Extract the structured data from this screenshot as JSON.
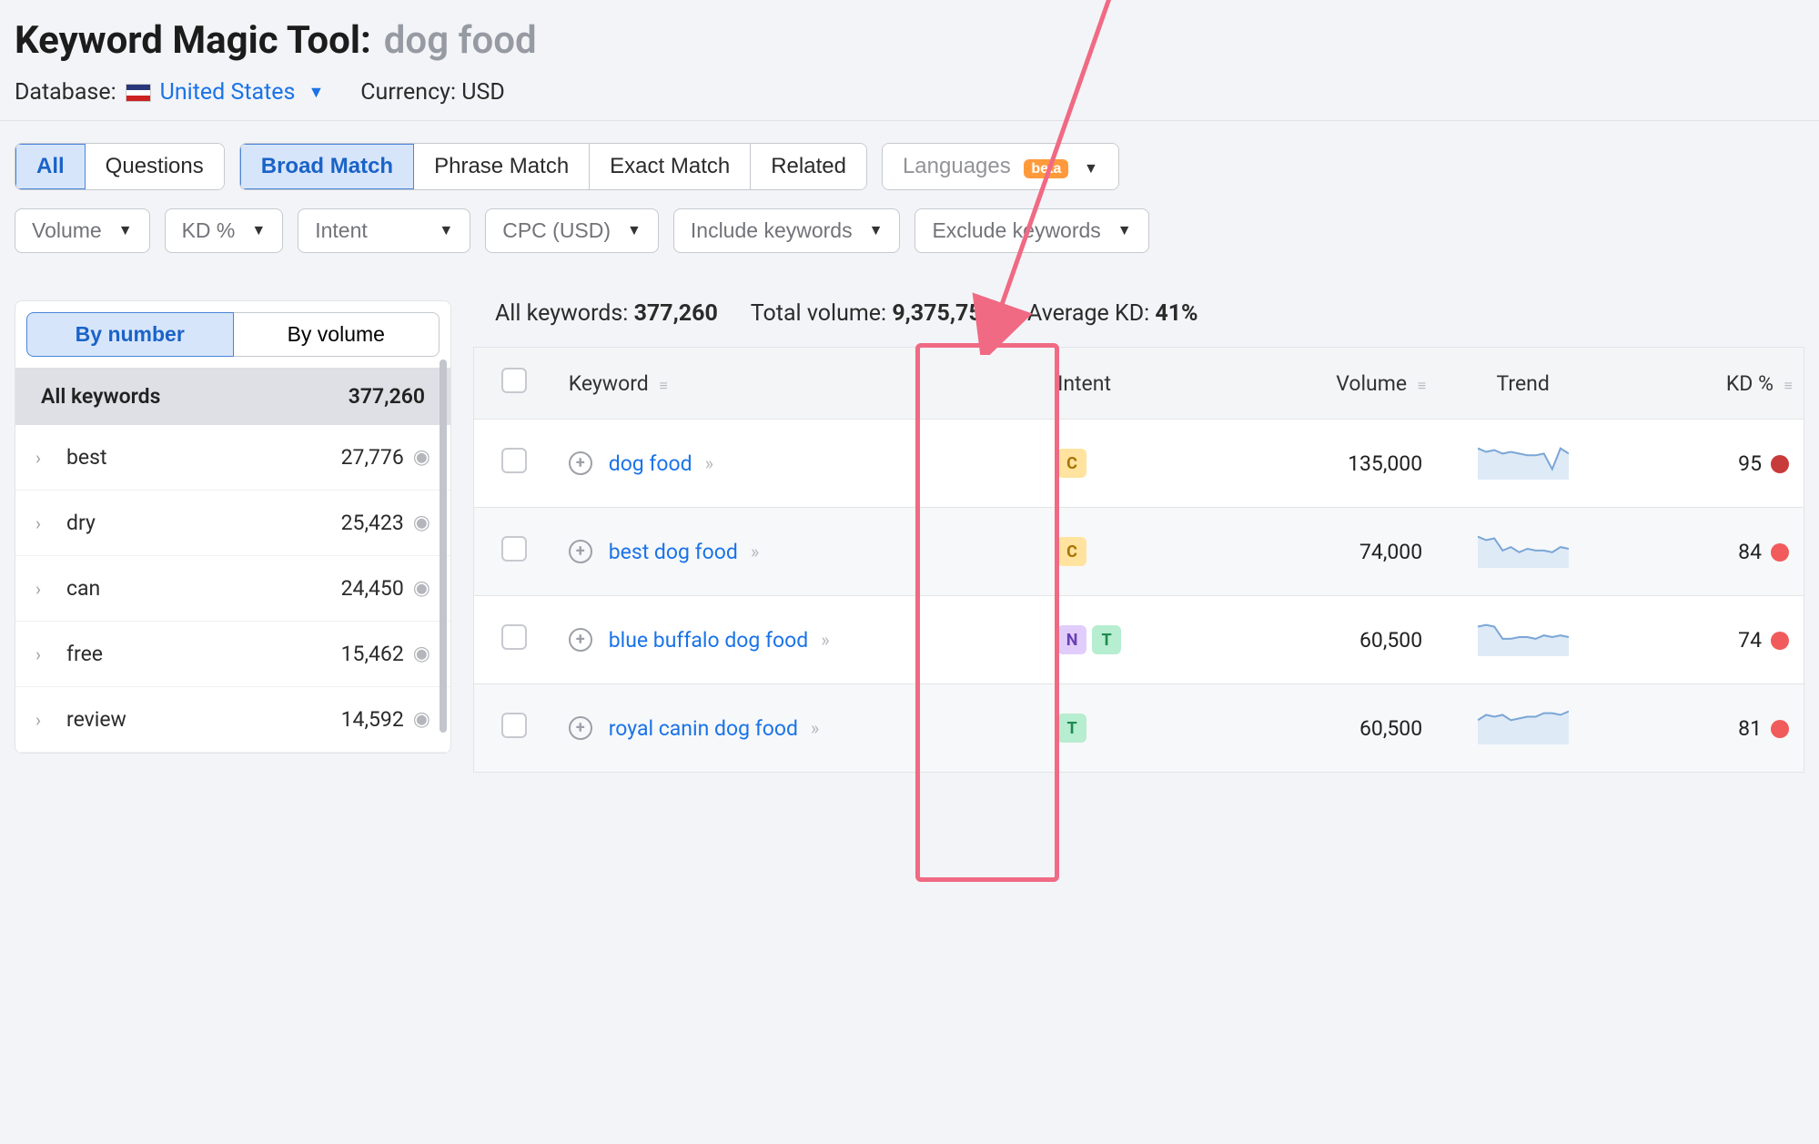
{
  "header": {
    "tool_name": "Keyword Magic Tool:",
    "query": "dog food",
    "database_label": "Database:",
    "country": "United States",
    "currency_label": "Currency: USD"
  },
  "filter_row1": {
    "all": "All",
    "questions": "Questions",
    "broad": "Broad Match",
    "phrase": "Phrase Match",
    "exact": "Exact Match",
    "related": "Related",
    "languages": "Languages",
    "beta": "beta"
  },
  "filter_row2": {
    "volume": "Volume",
    "kd": "KD %",
    "intent": "Intent",
    "cpc": "CPC (USD)",
    "include": "Include keywords",
    "exclude": "Exclude keywords"
  },
  "sidebar": {
    "tab_number": "By number",
    "tab_volume": "By volume",
    "all_label": "All keywords",
    "all_count": "377,260",
    "groups": [
      {
        "label": "best",
        "count": "27,776"
      },
      {
        "label": "dry",
        "count": "25,423"
      },
      {
        "label": "can",
        "count": "24,450"
      },
      {
        "label": "free",
        "count": "15,462"
      },
      {
        "label": "review",
        "count": "14,592"
      }
    ]
  },
  "summary": {
    "all_label": "All keywords:",
    "all_value": "377,260",
    "vol_label": "Total volume:",
    "vol_value": "9,375,750",
    "kd_label": "Average KD:",
    "kd_value": "41%"
  },
  "columns": {
    "keyword": "Keyword",
    "intent": "Intent",
    "volume": "Volume",
    "trend": "Trend",
    "kd": "KD %"
  },
  "rows": [
    {
      "keyword": "dog food",
      "intents": [
        "C"
      ],
      "volume": "135,000",
      "kd": "95",
      "kd_color": "#c83b3b",
      "trend": [
        18,
        16,
        17,
        15,
        16,
        15,
        14,
        14,
        15,
        6,
        18,
        15
      ]
    },
    {
      "keyword": "best dog food",
      "intents": [
        "C"
      ],
      "volume": "74,000",
      "kd": "84",
      "kd_color": "#f15b5b",
      "trend": [
        18,
        16,
        17,
        10,
        12,
        9,
        11,
        10,
        10,
        9,
        12,
        11
      ]
    },
    {
      "keyword": "blue buffalo dog food",
      "intents": [
        "N",
        "T"
      ],
      "volume": "60,500",
      "kd": "74",
      "kd_color": "#f15b5b",
      "trend": [
        17,
        18,
        17,
        10,
        10,
        11,
        11,
        10,
        12,
        11,
        12,
        11
      ]
    },
    {
      "keyword": "royal canin dog food",
      "intents": [
        "T"
      ],
      "volume": "60,500",
      "kd": "81",
      "kd_color": "#f15b5b",
      "trend": [
        14,
        17,
        16,
        17,
        14,
        15,
        16,
        16,
        18,
        18,
        17,
        19
      ]
    }
  ]
}
